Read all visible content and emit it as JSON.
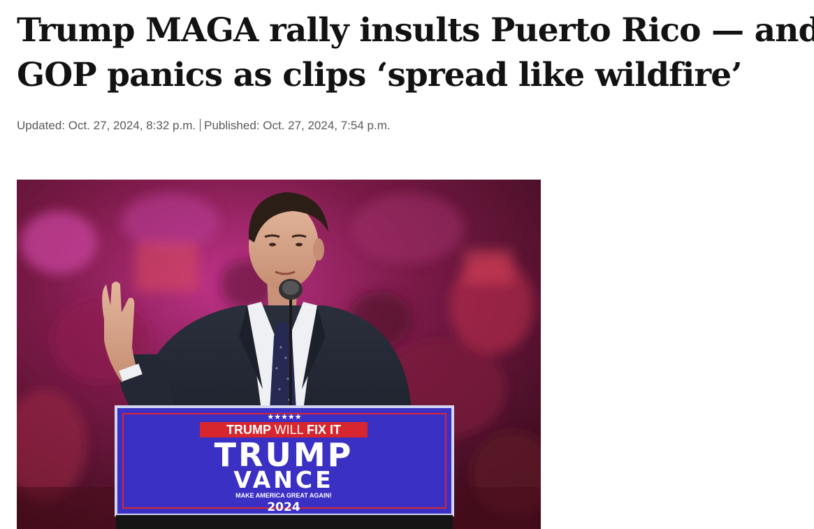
{
  "article": {
    "headline_line1": "Trump MAGA rally insults Puerto Rico — and",
    "headline_line2": "GOP panics as clips ‘spread like wildfire’",
    "updated": "Updated: Oct. 27, 2024, 8:32 p.m.",
    "published": "Published: Oct. 27, 2024, 7:54 p.m."
  },
  "photo": {
    "podium_stars": "★★★★★",
    "banner_text_part1": "TRUMP ",
    "banner_text_part2": "WILL ",
    "banner_text_part3": "FIX IT",
    "podium_line1": "TRUMP",
    "podium_line2": "VANCE",
    "podium_slogan": "MAKE AMERICA GREAT AGAIN!",
    "podium_year": "2024"
  },
  "colors": {
    "headline": "#121212",
    "meta": "#595959",
    "podium_blue": "#3a2ec2",
    "banner_red": "#d8262e",
    "crowd_magenta": "#b02a64"
  }
}
